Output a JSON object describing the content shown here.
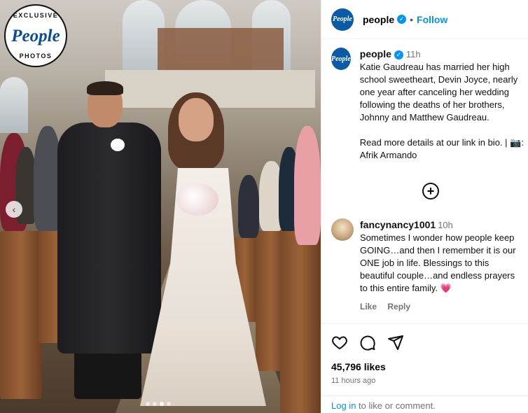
{
  "photo": {
    "badge_top": "EXCLUSIVE",
    "badge_logo": "People",
    "badge_bottom": "PHOTOS",
    "prev_arrow": "‹",
    "slide_count": 4,
    "active_slide": 3
  },
  "header": {
    "avatar_text": "People",
    "username": "people",
    "separator": "•",
    "follow_label": "Follow",
    "verified_icon": "verified-checkmark-icon"
  },
  "caption": {
    "username": "people",
    "time": "11h",
    "text": "Katie Gaudreau has married her high school sweetheart, Devin Joyce, nearly one year after canceling her wedding following the deaths of her brothers, Johnny and Matthew Gaudreau.\n\nRead more details at our link in bio. | 📷: Afrik Armando"
  },
  "load_more_icon": "+",
  "comment": {
    "username": "fancynancy1001",
    "time": "10h",
    "text": "Sometimes I wonder how people keep GOING…and then I remember it is our ONE job in life. Blessings to this beautiful couple…and endless prayers to this entire family.",
    "emoji": "💗",
    "like_label": "Like",
    "reply_label": "Reply"
  },
  "actions": {
    "likes": "45,796 likes",
    "posted": "11 hours ago",
    "icons": [
      "heart-icon",
      "comment-icon",
      "share-icon"
    ]
  },
  "login": {
    "link": "Log in",
    "rest": " to like or comment."
  },
  "colors": {
    "accent": "#0095f6",
    "brand": "#0a5aa8",
    "muted": "#737373"
  }
}
